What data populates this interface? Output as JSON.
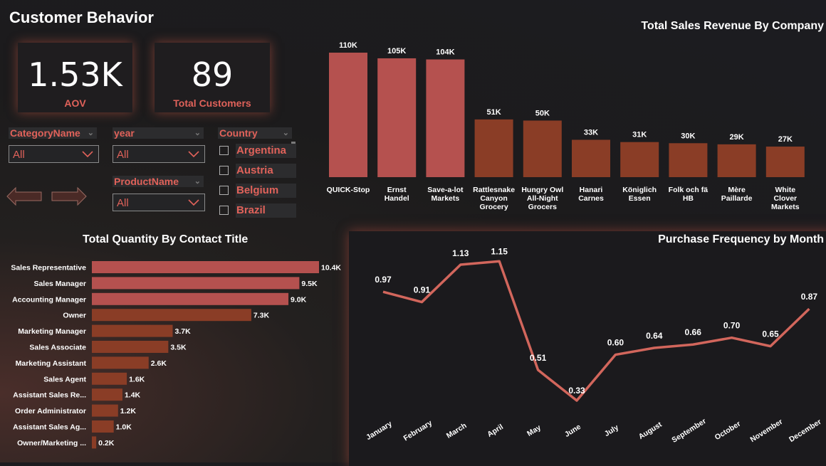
{
  "page_title": "Customer Behavior",
  "kpis": [
    {
      "value": "1.53K",
      "label": "AOV"
    },
    {
      "value": "89",
      "label": "Total Customers"
    }
  ],
  "slicers": {
    "category": {
      "header": "CategoryName",
      "value": "All"
    },
    "year": {
      "header": "year",
      "value": "All"
    },
    "product": {
      "header": "ProductName",
      "value": "All"
    },
    "country": {
      "header": "Country",
      "items": [
        "Argentina",
        "Austria",
        "Belgium",
        "Brazil"
      ]
    }
  },
  "colors": {
    "light_bar": "#b5514f",
    "dark_bar": "#8a3d26",
    "line": "#d2665c",
    "accent_text": "#e0625a"
  },
  "icons": {
    "back": "left-arrow-icon",
    "forward": "right-arrow-icon",
    "dropdown": "chevron-down-icon"
  },
  "chart_data": [
    {
      "type": "bar",
      "title": "Total Sales Revenue By Company",
      "categories": [
        "QUICK-Stop",
        "Ernst Handel",
        "Save-a-lot Markets",
        "Rattlesnake Canyon Grocery",
        "Hungry Owl All-Night Grocers",
        "Hanari Carnes",
        "Königlich Essen",
        "Folk och fä HB",
        "Mère Paillarde",
        "White Clover Markets"
      ],
      "category_lines": [
        [
          "QUICK-Stop"
        ],
        [
          "Ernst",
          "Handel"
        ],
        [
          "Save-a-lot",
          "Markets"
        ],
        [
          "Rattlesnake",
          "Canyon",
          "Grocery"
        ],
        [
          "Hungry Owl",
          "All-Night",
          "Grocers"
        ],
        [
          "Hanari",
          "Carnes"
        ],
        [
          "Königlich",
          "Essen"
        ],
        [
          "Folk och fä",
          "HB"
        ],
        [
          "Mère",
          "Paillarde"
        ],
        [
          "White",
          "Clover",
          "Markets"
        ]
      ],
      "values": [
        110000,
        105000,
        104000,
        51000,
        50000,
        33000,
        31000,
        30000,
        29000,
        27000
      ],
      "data_labels": [
        "110K",
        "105K",
        "104K",
        "51K",
        "50K",
        "33K",
        "31K",
        "30K",
        "29K",
        "27K"
      ],
      "ylim": [
        0,
        110000
      ]
    },
    {
      "type": "bar",
      "orientation": "horizontal",
      "title": "Total Quantity By Contact Title",
      "categories": [
        "Sales Representative",
        "Sales Manager",
        "Accounting Manager",
        "Owner",
        "Marketing Manager",
        "Sales Associate",
        "Marketing Assistant",
        "Sales Agent",
        "Assistant Sales Re...",
        "Order Administrator",
        "Assistant Sales Ag...",
        "Owner/Marketing ..."
      ],
      "values": [
        10400,
        9500,
        9000,
        7300,
        3700,
        3500,
        2600,
        1600,
        1400,
        1200,
        1000,
        200
      ],
      "data_labels": [
        "10.4K",
        "9.5K",
        "9.0K",
        "7.3K",
        "3.7K",
        "3.5K",
        "2.6K",
        "1.6K",
        "1.4K",
        "1.2K",
        "1.0K",
        "0.2K"
      ],
      "xlim": [
        0,
        10400
      ]
    },
    {
      "type": "line",
      "title": "Purchase Frequency by Month",
      "x": [
        "January",
        "February",
        "March",
        "April",
        "May",
        "June",
        "July",
        "August",
        "September",
        "October",
        "November",
        "December"
      ],
      "values": [
        0.97,
        0.91,
        1.13,
        1.15,
        0.51,
        0.33,
        0.6,
        0.64,
        0.66,
        0.7,
        0.65,
        0.87
      ],
      "data_labels": [
        "0.97",
        "0.91",
        "1.13",
        "1.15",
        "0.51",
        "0.33",
        "0.60",
        "0.64",
        "0.66",
        "0.70",
        "0.65",
        "0.87"
      ]
    }
  ]
}
